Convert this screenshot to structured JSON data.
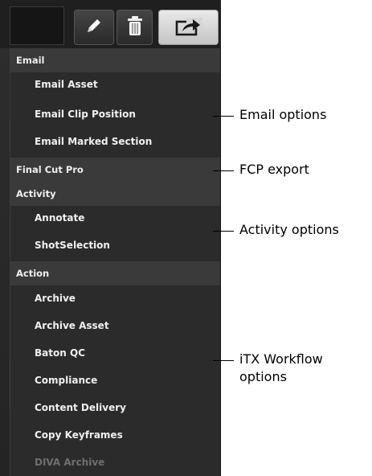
{
  "toolbar": {
    "buttons": [
      {
        "icon": "pencil-icon"
      },
      {
        "icon": "trash-icon"
      },
      {
        "icon": "share-icon"
      }
    ]
  },
  "menu": {
    "sections": [
      {
        "header": "Email",
        "items": [
          "Email Asset",
          "Email Clip Position",
          "Email Marked Section"
        ]
      },
      {
        "header": "Final Cut Pro",
        "items": []
      },
      {
        "header": "Activity",
        "items": [
          "Annotate",
          "ShotSelection"
        ]
      },
      {
        "header": "Action",
        "items": [
          "Archive",
          "Archive Asset",
          "Baton QC",
          "Compliance",
          "Content Delivery",
          "Copy Keyframes",
          "DIVA Archive"
        ]
      }
    ],
    "disabled_item": "DIVA Archive"
  },
  "callouts": {
    "email": "Email options",
    "fcp": "FCP export",
    "activity": "Activity options",
    "itx_line1": "iTX Workflow",
    "itx_line2": "options"
  },
  "colors": {
    "menu_bg": "#2b2b2b",
    "header_bg": "#3a3a3a",
    "text": "#f0f0f0",
    "disabled_text": "#6e6e6e"
  }
}
